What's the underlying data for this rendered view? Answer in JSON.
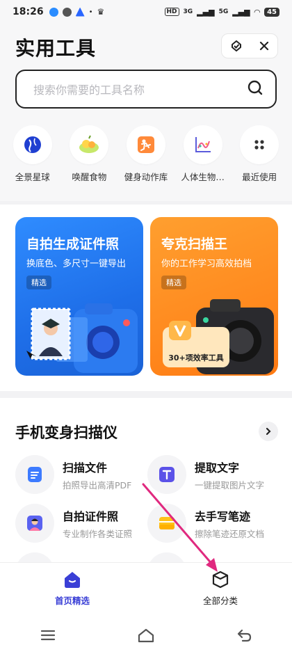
{
  "status": {
    "time": "18:26",
    "signal_left": "HD",
    "signal_a": "3G",
    "signal_b": "5G",
    "battery": "45"
  },
  "header": {
    "title": "实用工具"
  },
  "search": {
    "placeholder": "搜索你需要的工具名称"
  },
  "shortcuts": [
    {
      "label": "全景星球",
      "icon": "globe-icon"
    },
    {
      "label": "唤醒食物",
      "icon": "food-icon"
    },
    {
      "label": "健身动作库",
      "icon": "fitness-icon"
    },
    {
      "label": "人体生物…",
      "icon": "biology-chart-icon"
    },
    {
      "label": "最近使用",
      "icon": "recent-dots-icon"
    }
  ],
  "promos": [
    {
      "title": "自拍生成证件照",
      "subtitle": "换底色、多尺寸一键导出",
      "tag": "精选"
    },
    {
      "title": "夸克扫描王",
      "subtitle": "你的工作学习高效拍档",
      "tag": "精选",
      "badge": "30+项效率工具"
    }
  ],
  "scanner": {
    "title": "手机变身扫描仪",
    "tools": [
      {
        "name": "扫描文件",
        "desc": "拍照导出高清PDF"
      },
      {
        "name": "提取文字",
        "desc": "一键提取图片文字"
      },
      {
        "name": "自拍证件照",
        "desc": "专业制作各类证照"
      },
      {
        "name": "去手写笔迹",
        "desc": "擦除笔迹还原文档"
      }
    ]
  },
  "tabs": [
    {
      "label": "首页精选",
      "active": true
    },
    {
      "label": "全部分类",
      "active": false
    }
  ],
  "colors": {
    "accent": "#3a3fd6",
    "arrow": "#e0297f"
  }
}
